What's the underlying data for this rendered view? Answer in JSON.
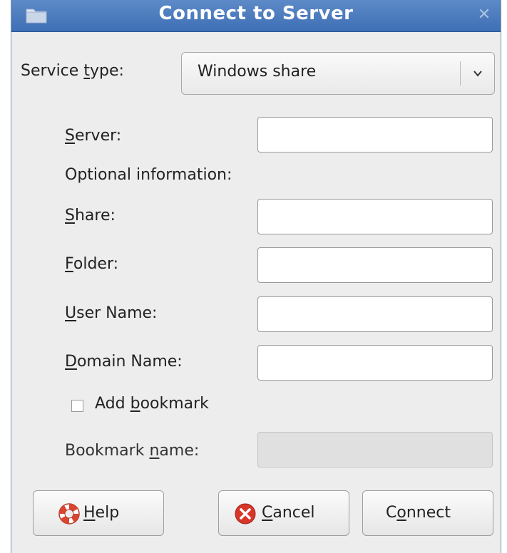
{
  "window": {
    "title": "Connect to Server",
    "close_glyph": "✕",
    "title_icon": "folder-icon",
    "title_bar_color": "#4a78bb"
  },
  "service": {
    "label_pre": "Service ",
    "label_mnemonic": "t",
    "label_post": "ype:",
    "selected": "Windows share"
  },
  "fields": {
    "server": {
      "mnemonic": "S",
      "rest": "erver:",
      "value": ""
    },
    "optional_info": "Optional information:",
    "share": {
      "mnemonic": "S",
      "rest": "hare:",
      "value": ""
    },
    "folder": {
      "mnemonic": "F",
      "rest": "older:",
      "value": ""
    },
    "user_name": {
      "mnemonic": "U",
      "rest": "ser Name:",
      "value": ""
    },
    "domain_name": {
      "mnemonic": "D",
      "rest": "omain Name:",
      "value": ""
    }
  },
  "bookmark": {
    "checkbox_pre": "Add ",
    "checkbox_mnemonic": "b",
    "checkbox_post": "ookmark",
    "checked": false,
    "name_pre": "Bookmark ",
    "name_mnemonic": "n",
    "name_post": "ame:",
    "name_value": ""
  },
  "buttons": {
    "help": {
      "mnemonic": "H",
      "rest": "elp",
      "icon": "lifebuoy-icon"
    },
    "cancel": {
      "mnemonic": "C",
      "rest": "ancel",
      "icon": "cancel-icon"
    },
    "connect": {
      "pre": "C",
      "mnemonic": "o",
      "rest": "nnect"
    }
  }
}
